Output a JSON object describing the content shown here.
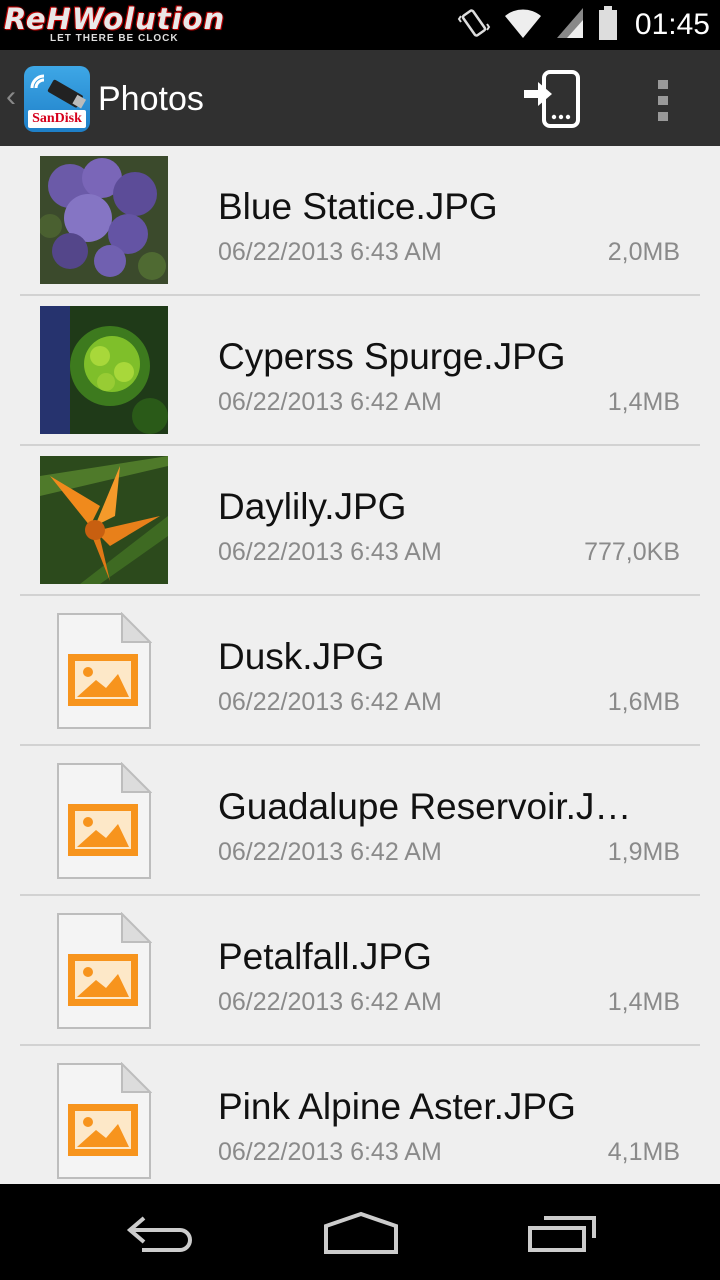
{
  "status_bar": {
    "logo_main": "ReHWolution",
    "logo_sub": "LET THERE BE CLOCK",
    "time": "01:45",
    "icons": [
      "vibrate-icon",
      "wifi-icon",
      "signal-icon",
      "battery-icon"
    ]
  },
  "action_bar": {
    "title": "Photos",
    "app_icon_brand": "SanDisk",
    "actions": [
      "transfer-to-device-icon",
      "overflow-menu-icon"
    ]
  },
  "files": [
    {
      "name": "Blue Statice.JPG",
      "date": "06/22/2013 6:43 AM",
      "size": "2,0MB",
      "thumb": "purple-flowers"
    },
    {
      "name": "Cyperss Spurge.JPG",
      "date": "06/22/2013 6:42 AM",
      "size": "1,4MB",
      "thumb": "green-plant"
    },
    {
      "name": "Daylily.JPG",
      "date": "06/22/2013 6:43 AM",
      "size": "777,0KB",
      "thumb": "orange-flower"
    },
    {
      "name": "Dusk.JPG",
      "date": "06/22/2013 6:42 AM",
      "size": "1,6MB",
      "thumb": "image-file-icon"
    },
    {
      "name": "Guadalupe Reservoir.J…",
      "date": "06/22/2013 6:42 AM",
      "size": "1,9MB",
      "thumb": "image-file-icon"
    },
    {
      "name": "Petalfall.JPG",
      "date": "06/22/2013 6:42 AM",
      "size": "1,4MB",
      "thumb": "image-file-icon"
    },
    {
      "name": "Pink Alpine Aster.JPG",
      "date": "06/22/2013 6:43 AM",
      "size": "4,1MB",
      "thumb": "image-file-icon"
    }
  ],
  "nav_bar": {
    "buttons": [
      "back-icon",
      "home-icon",
      "recent-apps-icon"
    ]
  },
  "colors": {
    "action_bar": "#303030",
    "list_background": "#efefef",
    "accent_orange": "#f7941d",
    "secondary_text": "#8a8a8a"
  }
}
